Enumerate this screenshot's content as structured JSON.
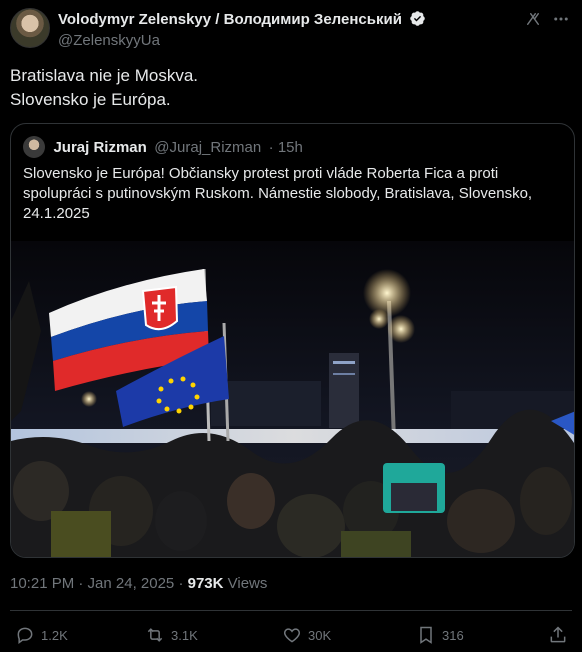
{
  "author": {
    "display_name": "Volodymyr Zelenskyy / Володимир Зеленський",
    "handle": "@ZelenskyyUa",
    "verified": true
  },
  "tweet": {
    "line1": "Bratislava nie je Moskva.",
    "line2": "Slovensko je Európa."
  },
  "quoted": {
    "name": "Juraj Rizman",
    "handle": "@Juraj_Rizman",
    "time": "· 15h",
    "text": "Slovensko je Európa! Občiansky protest proti vláde Roberta Fica a proti spolupráci s putinovským Ruskom. Námestie slobody, Bratislava, Slovensko, 24.1.2025",
    "image_description": "night protest crowd with Slovak and EU flags"
  },
  "meta": {
    "timestamp": "10:21 PM · Jan 24, 2025",
    "separator": " · ",
    "views_count": "973K",
    "views_label": " Views"
  },
  "actions": {
    "replies": "1.2K",
    "retweets": "3.1K",
    "likes": "30K",
    "bookmarks": "316"
  },
  "colors": {
    "background": "#000000",
    "text": "#e7e9ea",
    "secondary": "#71767b",
    "border": "#2f3336",
    "verified": "#1d9bf0"
  }
}
